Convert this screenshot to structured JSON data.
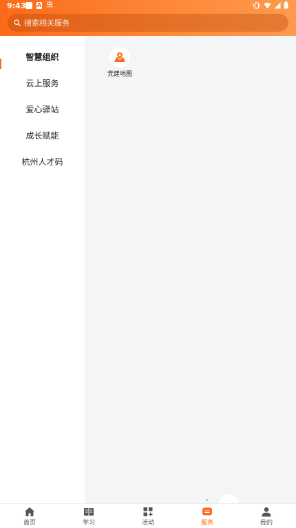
{
  "status_bar": {
    "time": "9:43",
    "notif_glyph_1": "A",
    "notif_glyph_2": "虫"
  },
  "search": {
    "placeholder": "搜索相关服务"
  },
  "categories": [
    {
      "label": "智慧组织",
      "active": true
    },
    {
      "label": "云上服务",
      "active": false
    },
    {
      "label": "爱心驿站",
      "active": false
    },
    {
      "label": "成长赋能",
      "active": false
    },
    {
      "label": "杭州人才码",
      "active": false
    }
  ],
  "services": [
    {
      "label": "党建地图",
      "icon": "map-pin-icon"
    }
  ],
  "tabbar": [
    {
      "label": "首页",
      "icon": "home-icon",
      "active": false
    },
    {
      "label": "学习",
      "icon": "book-icon",
      "active": false
    },
    {
      "label": "活动",
      "icon": "grid-icon",
      "active": false
    },
    {
      "label": "服务",
      "icon": "service-icon",
      "active": true
    },
    {
      "label": "我的",
      "icon": "user-icon",
      "active": false
    }
  ],
  "colors": {
    "accent": "#ff6a1a",
    "header_start": "#fb6a1a",
    "header_end": "#ff9a4c",
    "panel_bg": "#f4f5f7",
    "icon_gray": "#555555"
  }
}
